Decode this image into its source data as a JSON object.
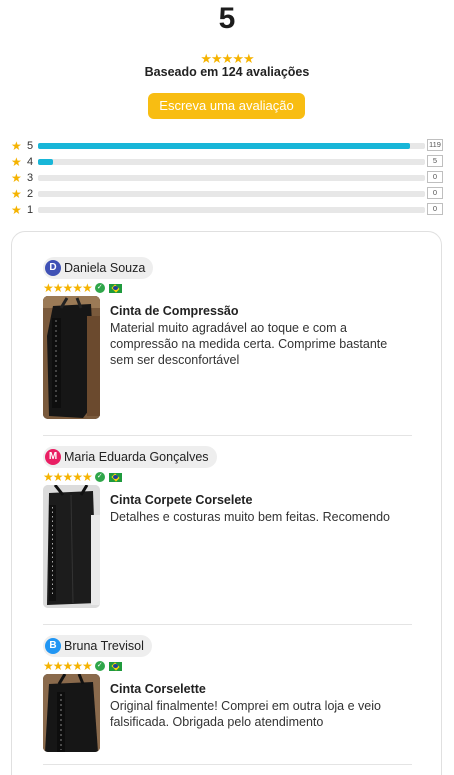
{
  "summary": {
    "score": "5",
    "stars": "★★★★★",
    "based_on": "Baseado em 124 avaliações",
    "write_button": "Escreva uma avaliação"
  },
  "distribution": [
    {
      "star_label": "5",
      "count": "119",
      "fraction": 0.96
    },
    {
      "star_label": "4",
      "count": "5",
      "fraction": 0.04
    },
    {
      "star_label": "3",
      "count": "0",
      "fraction": 0
    },
    {
      "star_label": "2",
      "count": "0",
      "fraction": 0
    },
    {
      "star_label": "1",
      "count": "0",
      "fraction": 0
    }
  ],
  "colors": {
    "accent_yellow": "#f8bd12",
    "bar_fill": "#18b6d8",
    "star": "#f5b301"
  },
  "reviews": [
    {
      "initial": "D",
      "avatar_color": "#3f51b5",
      "name": "Daniela Souza",
      "stars": "★★★★★",
      "product": "Cinta de Compressão",
      "text": "Material muito agradável ao toque e com a compressão na medida certa. Comprime bastante sem ser desconfortável"
    },
    {
      "initial": "M",
      "avatar_color": "#e91e63",
      "name": "Maria Eduarda Gonçalves",
      "stars": "★★★★★",
      "product": "Cinta Corpete Corselete",
      "text": "Detalhes e costuras muito bem feitas. Recomendo"
    },
    {
      "initial": "B",
      "avatar_color": "#2196f3",
      "name": "Bruna Trevisol",
      "stars": "★★★★★",
      "product": "Cinta Corselette",
      "text": "Original finalmente! Comprei em outra loja e veio falsificada. Obrigada pelo atendimento"
    }
  ]
}
